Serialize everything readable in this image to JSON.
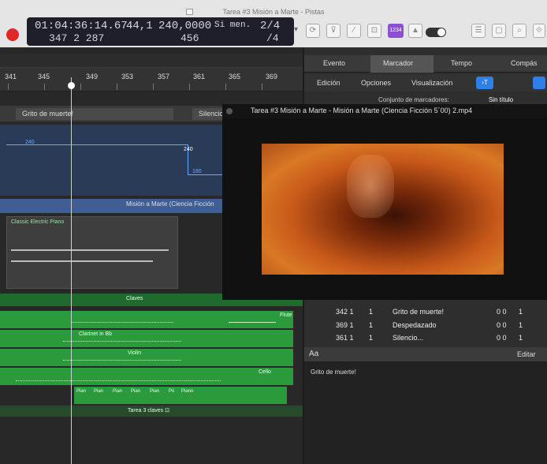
{
  "window": {
    "title": "Tarea #3 Misión a Marte - Pistas"
  },
  "lcd": {
    "time": "01:04:36:14.67",
    "bars": "347  2  287",
    "sample_rate": "44,1",
    "tempo": "240,0000",
    "tempo_sub": "456",
    "key": "Si men.",
    "signature_top": "2/4",
    "signature_bottom": "/4",
    "mode_badge": "1234"
  },
  "ruler": {
    "bars": [
      "341",
      "345",
      "349",
      "353",
      "357",
      "361",
      "365",
      "369"
    ]
  },
  "markers": [
    {
      "label": "Grito de muerte!"
    },
    {
      "label": "Silencio"
    }
  ],
  "automation": {
    "value_a": "240",
    "value_b": "240",
    "value_c": "180"
  },
  "regions": {
    "movie": "Misión a Marte (Ciencia Ficción",
    "piano": "Classic Electric Piano",
    "claves": "Claves",
    "flute": "Flute",
    "clarinet": "Clarinet in Bb",
    "violin": "Violin",
    "cello": "Cello",
    "tarea": "Tarea 3 claves ⊡",
    "piano_notes": [
      "Pian",
      "Pian",
      "Pian",
      "Pian",
      "Pian",
      "Pú",
      "Piano"
    ]
  },
  "right_panel": {
    "tabs": [
      "Evento",
      "Marcador",
      "Tempo",
      "Compás"
    ],
    "menus": [
      "Edición",
      "Opciones",
      "Visualización"
    ],
    "marker_set_label": "Conjunto de marcadores:",
    "marker_set_value": "Sin título",
    "list": [
      {
        "pos": "342 1",
        "n": "1",
        "name": "Grito de muerte!",
        "len": "0 0",
        "v": "1"
      },
      {
        "pos": "369 1",
        "n": "1",
        "name": "Despedazado",
        "len": "0 0",
        "v": "1"
      },
      {
        "pos": "361 1",
        "n": "1",
        "name": "Silencio...",
        "len": "0 0",
        "v": "1"
      }
    ],
    "text_label": "Aa",
    "edit_button": "Editar",
    "text_content": "Grito de muerte!"
  },
  "movie_window": {
    "title": "Tarea #3 Misión a Marte - Misión a Marte (Ciencia Ficción 5´00) 2.mp4"
  },
  "colors": {
    "accent": "#6ba7ff",
    "record": "#e0282b",
    "region_green": "#2b9a3b",
    "movie_orange": "#d97824"
  }
}
